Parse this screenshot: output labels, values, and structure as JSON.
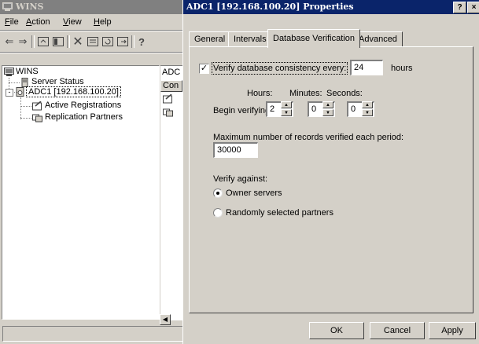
{
  "main_window": {
    "title": "WINS",
    "menu": [
      {
        "label": "File",
        "underline": "F",
        "rest": "ile"
      },
      {
        "label": "Action",
        "underline": "A",
        "rest": "ction"
      },
      {
        "label": "View",
        "underline": "V",
        "rest": "iew"
      },
      {
        "label": "Help",
        "underline": "H",
        "rest": "elp"
      }
    ],
    "tree": {
      "root": "WINS",
      "items": [
        "Server Status",
        "ADC1 [192.168.100.20]",
        "Active Registrations",
        "Replication Partners"
      ]
    },
    "right_panel": {
      "header": "ADC",
      "column": "Con"
    }
  },
  "dialog": {
    "title": "ADC1 [192.168.100.20] Properties",
    "help_button": "?",
    "close_button": "×",
    "tabs": [
      "General",
      "Intervals",
      "Database Verification",
      "Advanced"
    ],
    "active_tab": "Database Verification",
    "verify_label": "Verify database consistency every:",
    "verify_checked": true,
    "verify_value": "24",
    "verify_unit": "hours",
    "hours_label": "Hours:",
    "minutes_label": "Minutes:",
    "seconds_label": "Seconds:",
    "begin_label": "Begin verifying at:",
    "begin_hours": "2",
    "begin_minutes": "0",
    "begin_seconds": "0",
    "max_records_label": "Maximum number of records verified each period:",
    "max_records_value": "30000",
    "verify_against_label": "Verify against:",
    "radio_owner": "Owner servers",
    "radio_random": "Randomly selected partners",
    "selected_radio": "owner",
    "buttons": {
      "ok": "OK",
      "cancel": "Cancel",
      "apply": "Apply"
    }
  }
}
